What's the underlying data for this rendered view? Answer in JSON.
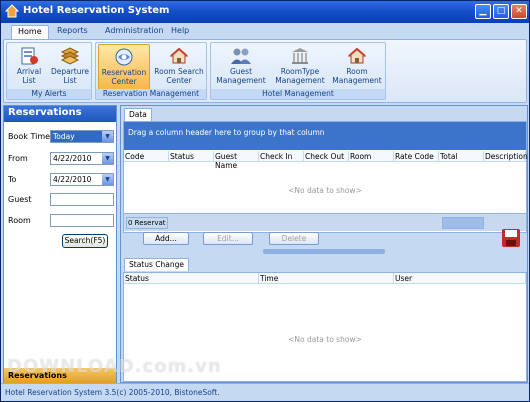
{
  "window": {
    "title": "Hotel Reservation System"
  },
  "ribbon": {
    "tabs": [
      "Home",
      "Reports",
      "Administration",
      "Help"
    ],
    "active_tab": "Home",
    "groups": [
      {
        "caption": "My Alerts",
        "buttons": [
          {
            "label1": "Arrival",
            "label2": "List",
            "icon": "arrival-list-icon"
          },
          {
            "label1": "Departure",
            "label2": "List",
            "icon": "departure-list-icon"
          }
        ]
      },
      {
        "caption": "Reservation Management",
        "buttons": [
          {
            "label1": "Reservation",
            "label2": "Center",
            "icon": "reservation-center-icon"
          },
          {
            "label1": "Room Search",
            "label2": "Center",
            "icon": "room-search-icon"
          }
        ]
      },
      {
        "caption": "Hotel Management",
        "buttons": [
          {
            "label1": "Guest",
            "label2": "Management",
            "icon": "guest-management-icon"
          },
          {
            "label1": "RoomType",
            "label2": "Management",
            "icon": "roomtype-management-icon"
          },
          {
            "label1": "Room",
            "label2": "Management",
            "icon": "room-management-icon"
          }
        ]
      }
    ]
  },
  "left_panel": {
    "title": "Reservations",
    "book_time_label": "Book Time",
    "book_time_value": "Today",
    "from_label": "From",
    "from_value": "4/22/2010",
    "to_label": "To",
    "to_value": "4/22/2010",
    "guest_label": "Guest",
    "room_label": "Room",
    "search_button": "Search(F5)",
    "footer": "Reservations"
  },
  "data_tab": {
    "tab_label": "Data",
    "group_hint": "Drag a column header here to group by that column",
    "columns": [
      "Code",
      "Status",
      "Guest Name",
      "Check In",
      "Check Out",
      "Room",
      "Rate Code",
      "Total",
      "Description"
    ],
    "no_data": "<No data to show>",
    "count_text": "0 Reservat"
  },
  "actions": {
    "add": "Add...",
    "edit": "Edit...",
    "delete": "Delete"
  },
  "status_change": {
    "tab_label": "Status Change",
    "columns": [
      "Status",
      "Time",
      "User"
    ],
    "no_data": "<No data to show>"
  },
  "statusbar": {
    "text": "Hotel Reservation System 3.5(c) 2005-2010, BistoneSoft."
  },
  "watermark": "DOWNLOAD.com.vn",
  "colors": {
    "title_blue": "#1550c8",
    "ribbon_bg": "#c6d9f3",
    "selected_orange": "#f8b74a",
    "group_bar": "#3b74c9"
  }
}
